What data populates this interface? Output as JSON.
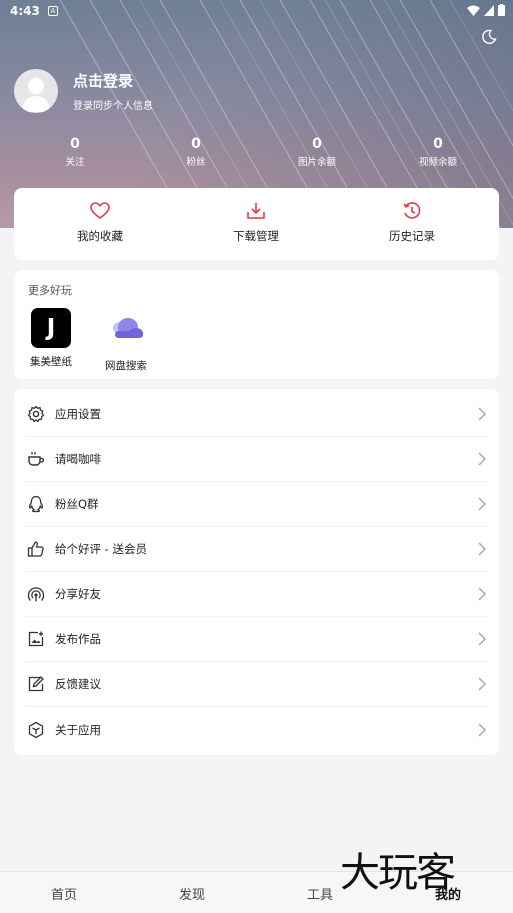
{
  "status": {
    "time": "4:43",
    "badge": "A"
  },
  "profile": {
    "title": "点击登录",
    "subtitle": "登录同步个人信息"
  },
  "stats": [
    {
      "value": "0",
      "label": "关注"
    },
    {
      "value": "0",
      "label": "粉丝"
    },
    {
      "value": "0",
      "label": "图片余额"
    },
    {
      "value": "0",
      "label": "视频余额"
    }
  ],
  "quick_actions": [
    {
      "label": "我的收藏",
      "icon": "heart-icon"
    },
    {
      "label": "下载管理",
      "icon": "download-icon"
    },
    {
      "label": "历史记录",
      "icon": "history-icon"
    }
  ],
  "more": {
    "title": "更多好玩",
    "apps": [
      {
        "label": "集美壁纸",
        "glyph": "J",
        "icon": "jimei-app-icon"
      },
      {
        "label": "网盘搜索",
        "icon": "cloud-icon"
      }
    ]
  },
  "menu": [
    {
      "label": "应用设置",
      "icon": "gear-icon"
    },
    {
      "label": "请喝咖啡",
      "icon": "coffee-icon"
    },
    {
      "label": "粉丝Q群",
      "icon": "qq-icon"
    },
    {
      "label": "给个好评 - 送会员",
      "icon": "thumbs-up-icon"
    },
    {
      "label": "分享好友",
      "icon": "share-signal-icon"
    },
    {
      "label": "发布作品",
      "icon": "publish-image-icon"
    },
    {
      "label": "反馈建议",
      "icon": "feedback-edit-icon"
    },
    {
      "label": "关于应用",
      "icon": "hexagon-info-icon"
    }
  ],
  "tabs": [
    {
      "label": "首页"
    },
    {
      "label": "发现"
    },
    {
      "label": "工具"
    },
    {
      "label": "我的"
    }
  ],
  "watermark": "大玩客",
  "colors": {
    "accent": "#e8374f",
    "cloud": "#6f63e0",
    "background": "#f4f4f6"
  }
}
